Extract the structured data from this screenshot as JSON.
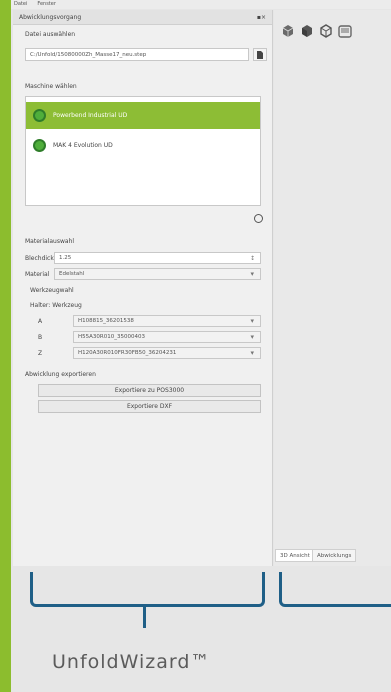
{
  "menubar": {
    "items": [
      "Datei",
      "Fenster"
    ]
  },
  "panel": {
    "title": "Abwicklungsvorgang",
    "title_controls": "▪×",
    "file_section_label": "Datei auswählen",
    "file_path": "C:/Unfold/15080000Zh_Masse17_neu.step",
    "machine_section_label": "Maschine wählen",
    "machines": [
      {
        "label": "Powerbend Industrial UD",
        "selected": true
      },
      {
        "label": "MAK 4 Evolution UD",
        "selected": false
      }
    ],
    "material_section_label": "Materialauswahl",
    "thickness_label": "Blechdicke",
    "thickness_value": "1.25",
    "material_label": "Material",
    "material_value": "Edelstahl",
    "tool_section_label": "Werkzeugwahl",
    "tool_header": "Halter: Werkzeug",
    "tools": [
      {
        "key": "A",
        "value": "H108815_36201538"
      },
      {
        "key": "B",
        "value": "H55A30R010_35000403"
      },
      {
        "key": "Z",
        "value": "H120A30R010FR30FB50_36204231"
      }
    ],
    "export_section_label": "Abwicklung exportieren",
    "export_buttons": [
      "Exportiere zu POS3000",
      "Exportiere DXF"
    ]
  },
  "viewport": {
    "tabs": [
      "3D Ansicht",
      "Abwicklungs"
    ]
  },
  "product_name": "UnfoldWizard™",
  "colors": {
    "accent_green": "#8cbd2e",
    "bracket_blue": "#1f5f87"
  }
}
